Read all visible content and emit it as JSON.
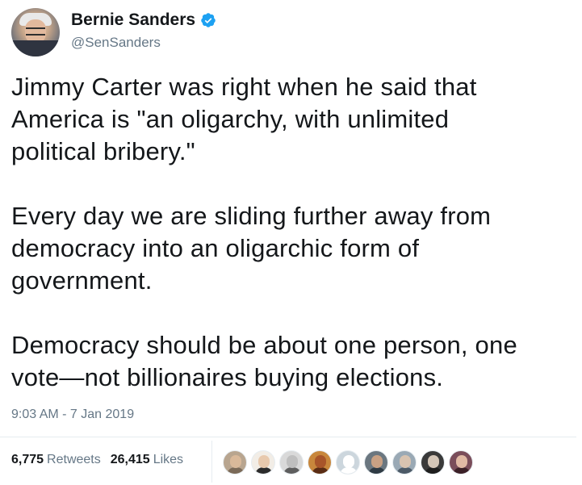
{
  "author": {
    "display_name": "Bernie Sanders",
    "handle": "@SenSanders",
    "verified_icon": "verified-badge-icon",
    "verified_color": "#1da1f2"
  },
  "tweet": {
    "text": "Jimmy Carter was right when he said that\nAmerica is \"an oligarchy, with unlimited\npolitical bribery.\"\n\nEvery day we are sliding further away from\ndemocracy into an oligarchic form of\ngovernment.\n\nDemocracy should be about one person, one\nvote—not billionaires buying elections.",
    "timestamp": "9:03 AM - 7 Jan 2019"
  },
  "stats": {
    "retweets_count": "6,775",
    "retweets_label": "Retweets",
    "likes_count": "26,415",
    "likes_label": "Likes"
  },
  "liker_avatars": [
    {
      "bg": "#b8a58f",
      "skin": "#d9b99a",
      "body": "#7b6a58"
    },
    {
      "bg": "#f2ede6",
      "skin": "#e8c9ad",
      "body": "#2b2b2b"
    },
    {
      "bg": "#d9d9d9",
      "skin": "#bfbfbf",
      "body": "#5e5e5e"
    },
    {
      "bg": "#c8873c",
      "skin": "#a8552a",
      "body": "#5a2c14"
    },
    {
      "bg": "#ccd6dd",
      "skin": "#ffffff",
      "body": "#ffffff"
    },
    {
      "bg": "#6b7780",
      "skin": "#c9a184",
      "body": "#2f3b44"
    },
    {
      "bg": "#9aa9b5",
      "skin": "#d8c3b0",
      "body": "#4c5a67"
    },
    {
      "bg": "#3a3a3a",
      "skin": "#d4c6b8",
      "body": "#1e1e1e"
    },
    {
      "bg": "#7a4d5a",
      "skin": "#e0b9a4",
      "body": "#3b2027"
    }
  ]
}
